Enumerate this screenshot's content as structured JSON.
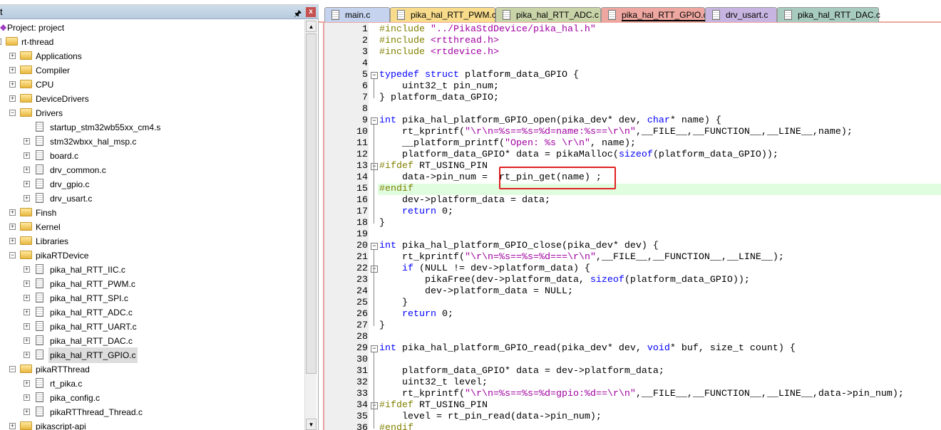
{
  "panel": {
    "title": "t",
    "pin_icon": "pin-icon",
    "close_label": "x"
  },
  "tree": [
    {
      "label": "Project: project",
      "depth": 0,
      "type": "project"
    },
    {
      "label": "rt-thread",
      "depth": 1,
      "type": "root",
      "exp": "-"
    },
    {
      "label": "Applications",
      "depth": 2,
      "type": "folder",
      "exp": "+"
    },
    {
      "label": "Compiler",
      "depth": 2,
      "type": "folder",
      "exp": "+"
    },
    {
      "label": "CPU",
      "depth": 2,
      "type": "folder",
      "exp": "+"
    },
    {
      "label": "DeviceDrivers",
      "depth": 2,
      "type": "folder",
      "exp": "+"
    },
    {
      "label": "Drivers",
      "depth": 2,
      "type": "folder",
      "exp": "-"
    },
    {
      "label": "startup_stm32wb55xx_cm4.s",
      "depth": 3,
      "type": "file",
      "exp": ""
    },
    {
      "label": "stm32wbxx_hal_msp.c",
      "depth": 3,
      "type": "file",
      "exp": "+"
    },
    {
      "label": "board.c",
      "depth": 3,
      "type": "file",
      "exp": "+"
    },
    {
      "label": "drv_common.c",
      "depth": 3,
      "type": "file",
      "exp": "+"
    },
    {
      "label": "drv_gpio.c",
      "depth": 3,
      "type": "file",
      "exp": "+"
    },
    {
      "label": "drv_usart.c",
      "depth": 3,
      "type": "file",
      "exp": "+"
    },
    {
      "label": "Finsh",
      "depth": 2,
      "type": "folder",
      "exp": "+"
    },
    {
      "label": "Kernel",
      "depth": 2,
      "type": "folder",
      "exp": "+"
    },
    {
      "label": "Libraries",
      "depth": 2,
      "type": "folder",
      "exp": "+"
    },
    {
      "label": "pikaRTDevice",
      "depth": 2,
      "type": "folder",
      "exp": "-"
    },
    {
      "label": "pika_hal_RTT_IIC.c",
      "depth": 3,
      "type": "file",
      "exp": "+"
    },
    {
      "label": "pika_hal_RTT_PWM.c",
      "depth": 3,
      "type": "file",
      "exp": "+"
    },
    {
      "label": "pika_hal_RTT_SPI.c",
      "depth": 3,
      "type": "file",
      "exp": "+"
    },
    {
      "label": "pika_hal_RTT_ADC.c",
      "depth": 3,
      "type": "file",
      "exp": "+"
    },
    {
      "label": "pika_hal_RTT_UART.c",
      "depth": 3,
      "type": "file",
      "exp": "+"
    },
    {
      "label": "pika_hal_RTT_DAC.c",
      "depth": 3,
      "type": "file",
      "exp": "+"
    },
    {
      "label": "pika_hal_RTT_GPIO.c",
      "depth": 3,
      "type": "file",
      "exp": "+",
      "selected": true
    },
    {
      "label": "pikaRTThread",
      "depth": 2,
      "type": "folder",
      "exp": "-"
    },
    {
      "label": "rt_pika.c",
      "depth": 3,
      "type": "file",
      "exp": "+"
    },
    {
      "label": "pika_config.c",
      "depth": 3,
      "type": "file",
      "exp": "+"
    },
    {
      "label": "pikaRTThread_Thread.c",
      "depth": 3,
      "type": "file",
      "exp": "+"
    },
    {
      "label": "pikascript-api",
      "depth": 2,
      "type": "folder",
      "exp": "+"
    }
  ],
  "tabs": [
    {
      "label": "main.c",
      "color": "#c5d3ee"
    },
    {
      "label": "pika_hal_RTT_PWM.c",
      "color": "#f8dc8c"
    },
    {
      "label": "pika_hal_RTT_ADC.c",
      "color": "#c8d4a8"
    },
    {
      "label": "pika_hal_RTT_GPIO.c",
      "color": "#eea7a0",
      "active": true
    },
    {
      "label": "drv_usart.c",
      "color": "#c8b4e0"
    },
    {
      "label": "pika_hal_RTT_DAC.c",
      "color": "#a8cbc0"
    }
  ],
  "code": {
    "highlight_line": 15,
    "boxed_line": 14,
    "fold_starts": [
      5,
      9,
      13,
      20,
      22,
      29,
      34
    ],
    "lines": [
      [
        [
          "pp",
          "#include "
        ],
        [
          "str",
          "\"../PikaStdDevice/pika_hal.h\""
        ]
      ],
      [
        [
          "pp",
          "#include "
        ],
        [
          "str",
          "<rtthread.h>"
        ]
      ],
      [
        [
          "pp",
          "#include "
        ],
        [
          "str",
          "<rtdevice.h>"
        ]
      ],
      [],
      [
        [
          "kw",
          "typedef"
        ],
        [
          "",
          " "
        ],
        [
          "kw",
          "struct"
        ],
        [
          "",
          " platform_data_GPIO {"
        ]
      ],
      [
        [
          "",
          "    uint32_t pin_num;"
        ]
      ],
      [
        [
          "",
          "} platform_data_GPIO;"
        ]
      ],
      [],
      [
        [
          "kw",
          "int"
        ],
        [
          "",
          " pika_hal_platform_GPIO_open(pika_dev* dev, "
        ],
        [
          "kw",
          "char"
        ],
        [
          "",
          "* name) {"
        ]
      ],
      [
        [
          "",
          "    rt_kprintf("
        ],
        [
          "str",
          "\"\\r\\n=%s==%s=%d=name:%s==\\r\\n\""
        ],
        [
          "",
          ",__FILE__,__FUNCTION__,__LINE__,name);"
        ]
      ],
      [
        [
          "",
          "    __platform_printf("
        ],
        [
          "str",
          "\"Open: %s \\r\\n\""
        ],
        [
          "",
          ", name);"
        ]
      ],
      [
        [
          "",
          "    platform_data_GPIO* data = pikaMalloc("
        ],
        [
          "kw",
          "sizeof"
        ],
        [
          "",
          "(platform_data_GPIO));"
        ]
      ],
      [
        [
          "pp",
          "#ifdef"
        ],
        [
          "",
          " RT_USING_PIN"
        ]
      ],
      [
        [
          "",
          "    data->pin_num =  rt_pin_get(name) ;"
        ]
      ],
      [
        [
          "pp",
          "#endif"
        ]
      ],
      [
        [
          "",
          "    dev->platform_data = data;"
        ]
      ],
      [
        [
          "",
          "    "
        ],
        [
          "kw",
          "return"
        ],
        [
          "",
          " 0;"
        ]
      ],
      [
        [
          "",
          "}"
        ]
      ],
      [],
      [
        [
          "kw",
          "int"
        ],
        [
          "",
          " pika_hal_platform_GPIO_close(pika_dev* dev) {"
        ]
      ],
      [
        [
          "",
          "    rt_kprintf("
        ],
        [
          "str",
          "\"\\r\\n=%s==%s=%d===\\r\\n\""
        ],
        [
          "",
          ",__FILE__,__FUNCTION__,__LINE__);"
        ]
      ],
      [
        [
          "",
          "    "
        ],
        [
          "kw",
          "if"
        ],
        [
          "",
          " (NULL != dev->platform_data) {"
        ]
      ],
      [
        [
          "",
          "        pikaFree(dev->platform_data, "
        ],
        [
          "kw",
          "sizeof"
        ],
        [
          "",
          "(platform_data_GPIO));"
        ]
      ],
      [
        [
          "",
          "        dev->platform_data = NULL;"
        ]
      ],
      [
        [
          "",
          "    }"
        ]
      ],
      [
        [
          "",
          "    "
        ],
        [
          "kw",
          "return"
        ],
        [
          "",
          " 0;"
        ]
      ],
      [
        [
          "",
          "}"
        ]
      ],
      [],
      [
        [
          "kw",
          "int"
        ],
        [
          "",
          " pika_hal_platform_GPIO_read(pika_dev* dev, "
        ],
        [
          "kw",
          "void"
        ],
        [
          "",
          "* buf, size_t count) {"
        ]
      ],
      [],
      [
        [
          "",
          "    platform_data_GPIO* data = dev->platform_data;"
        ]
      ],
      [
        [
          "",
          "    uint32_t level;"
        ]
      ],
      [
        [
          "",
          "    rt_kprintf("
        ],
        [
          "str",
          "\"\\r\\n=%s==%s=%d=gpio:%d==\\r\\n\""
        ],
        [
          "",
          ",__FILE__,__FUNCTION__,__LINE__,data->pin_num);"
        ]
      ],
      [
        [
          "pp",
          "#ifdef"
        ],
        [
          "",
          " RT_USING_PIN"
        ]
      ],
      [
        [
          "",
          "    level = rt_pin_read(data->pin_num);"
        ]
      ],
      [
        [
          "pp",
          "#endif"
        ]
      ]
    ]
  }
}
